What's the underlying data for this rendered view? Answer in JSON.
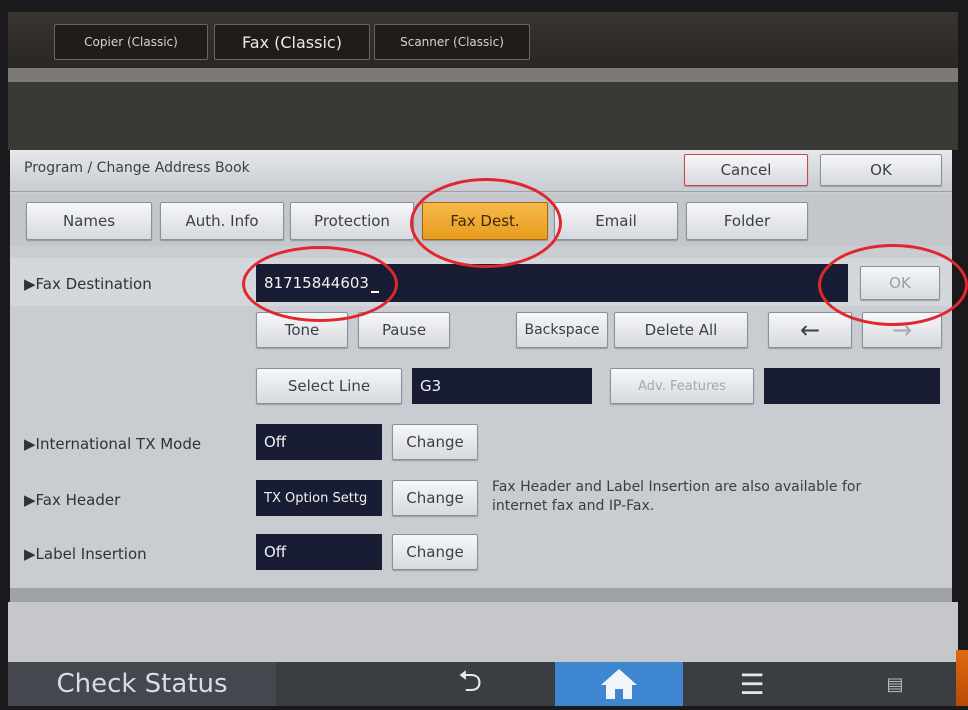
{
  "app_tabs": [
    "Copier (Classic)",
    "Fax (Classic)",
    "Scanner (Classic)"
  ],
  "dialog": {
    "title": "Program / Change Address Book",
    "cancel_label": "Cancel",
    "ok_label": "OK"
  },
  "tabs": [
    "Names",
    "Auth. Info",
    "Protection",
    "Fax Dest.",
    "Email",
    "Folder"
  ],
  "fax_destination": {
    "label": "▶Fax Destination",
    "value": "81715844603",
    "ok_label": "OK"
  },
  "keypad": {
    "tone_label": "Tone",
    "pause_label": "Pause",
    "backspace_label": "Backspace",
    "delete_all_label": "Delete All",
    "left_arrow": "←",
    "right_arrow": "→"
  },
  "line": {
    "select_line_label": "Select Line",
    "value": "G3",
    "adv_features_label": "Adv. Features"
  },
  "intl_tx": {
    "label": "▶International TX Mode",
    "value": "Off",
    "change_label": "Change"
  },
  "fax_header": {
    "label": "▶Fax Header",
    "value": "TX Option Settg",
    "change_label": "Change",
    "note": "Fax Header and Label Insertion are also available for internet fax and IP-Fax."
  },
  "label_insertion": {
    "label": "▶Label Insertion",
    "value": "Off",
    "change_label": "Change"
  },
  "status_bar": {
    "check_status": "Check Status",
    "back_glyph": "⮌",
    "home_glyph": "⌂",
    "menu_glyph": "☰",
    "small_glyph": "▤"
  },
  "colors": {
    "accent_tab": "#f0a830",
    "highlight_ring": "#e1262d",
    "home_blue": "#3e86cf",
    "field_dark": "#191d33"
  }
}
